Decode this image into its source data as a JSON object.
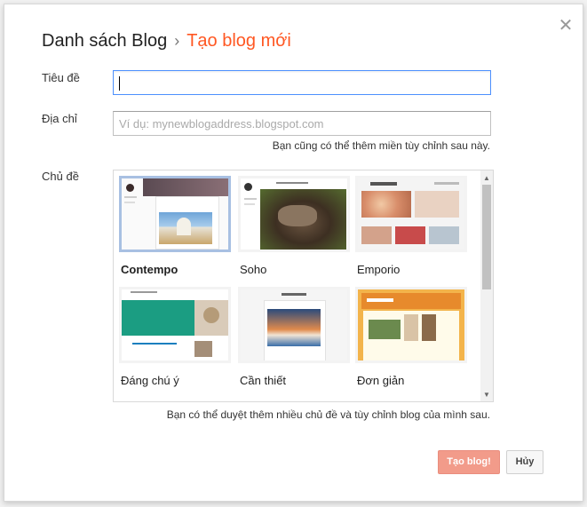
{
  "dialog": {
    "breadcrumb_parent": "Danh sách Blog",
    "breadcrumb_separator": "›",
    "breadcrumb_current": "Tạo blog mới",
    "close_icon": "close-icon"
  },
  "form": {
    "title_label": "Tiêu đề",
    "title_value": "",
    "address_label": "Địa chỉ",
    "address_placeholder": "Ví dụ: mynewblogaddress.blogspot.com",
    "address_hint": "Bạn cũng có thể thêm miền tùy chỉnh sau này.",
    "theme_label": "Chủ đề",
    "theme_hint": "Bạn có thể duyệt thêm nhiều chủ đề và tùy chỉnh blog của mình sau."
  },
  "themes": [
    {
      "name": "Contempo",
      "selected": true
    },
    {
      "name": "Soho",
      "selected": false
    },
    {
      "name": "Emporio",
      "selected": false
    },
    {
      "name": "Đáng chú ý",
      "selected": false
    },
    {
      "name": "Cần thiết",
      "selected": false
    },
    {
      "name": "Đơn giản",
      "selected": false
    }
  ],
  "buttons": {
    "create": "Tạo blog!",
    "cancel": "Hủy"
  },
  "colors": {
    "accent": "#ff5722",
    "create_button": "#f29b8a",
    "focus_border": "#4d90fe",
    "selected_theme_border": "#a8c0e2"
  }
}
